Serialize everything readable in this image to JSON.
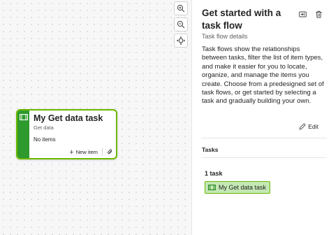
{
  "canvas": {
    "zoom_in_icon": "zoom-in-icon",
    "zoom_out_icon": "zoom-out-icon",
    "fit_icon": "fit-to-screen-icon"
  },
  "task_card": {
    "title": "My Get data task",
    "subtitle": "Get data",
    "items_text": "No items",
    "new_item_label": "New item",
    "accent_color": "#2e9a2e",
    "border_color": "#6bb700"
  },
  "panel": {
    "title": "Get started with a task flow",
    "subtitle": "Task flow details",
    "description": "Task flows show the relationships between tasks, filter the list of item types, and make it easier for you to locate, organize, and manage the items you create. Choose from a predesigned set of task flows, or get started by selecting a task and gradually building your own.",
    "edit_label": "Edit",
    "tasks_section_label": "Tasks",
    "task_count": "1 task",
    "tasks": [
      {
        "name": "My Get data task"
      }
    ]
  }
}
